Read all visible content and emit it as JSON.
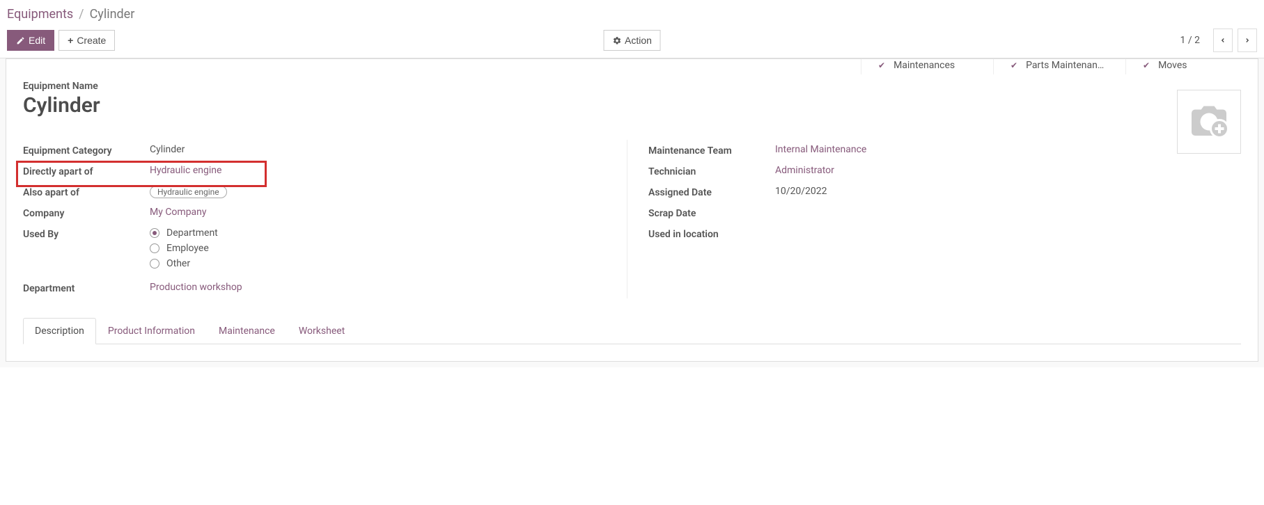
{
  "breadcrumb": {
    "root": "Equipments",
    "current": "Cylinder"
  },
  "toolbar": {
    "edit": "Edit",
    "create": "Create",
    "action": "Action"
  },
  "pager": {
    "text": "1 / 2"
  },
  "stat_buttons": [
    {
      "label": "Maintenances"
    },
    {
      "label": "Parts Maintenan…"
    },
    {
      "label": "Moves"
    }
  ],
  "title": {
    "label": "Equipment Name",
    "value": "Cylinder"
  },
  "left_fields": {
    "equipment_category": {
      "label": "Equipment Category",
      "value": "Cylinder"
    },
    "directly_apart_of": {
      "label": "Directly apart of",
      "value": "Hydraulic engine"
    },
    "also_apart_of": {
      "label": "Also apart of",
      "tag": "Hydraulic engine"
    },
    "company": {
      "label": "Company",
      "value": "My Company"
    },
    "used_by": {
      "label": "Used By",
      "options": [
        {
          "label": "Department",
          "checked": true
        },
        {
          "label": "Employee",
          "checked": false
        },
        {
          "label": "Other",
          "checked": false
        }
      ]
    },
    "department": {
      "label": "Department",
      "value": "Production workshop"
    }
  },
  "right_fields": {
    "maintenance_team": {
      "label": "Maintenance Team",
      "value": "Internal Maintenance"
    },
    "technician": {
      "label": "Technician",
      "value": "Administrator"
    },
    "assigned_date": {
      "label": "Assigned Date",
      "value": "10/20/2022"
    },
    "scrap_date": {
      "label": "Scrap Date",
      "value": ""
    },
    "used_in_location": {
      "label": "Used in location",
      "value": ""
    }
  },
  "tabs": [
    "Description",
    "Product Information",
    "Maintenance",
    "Worksheet"
  ]
}
